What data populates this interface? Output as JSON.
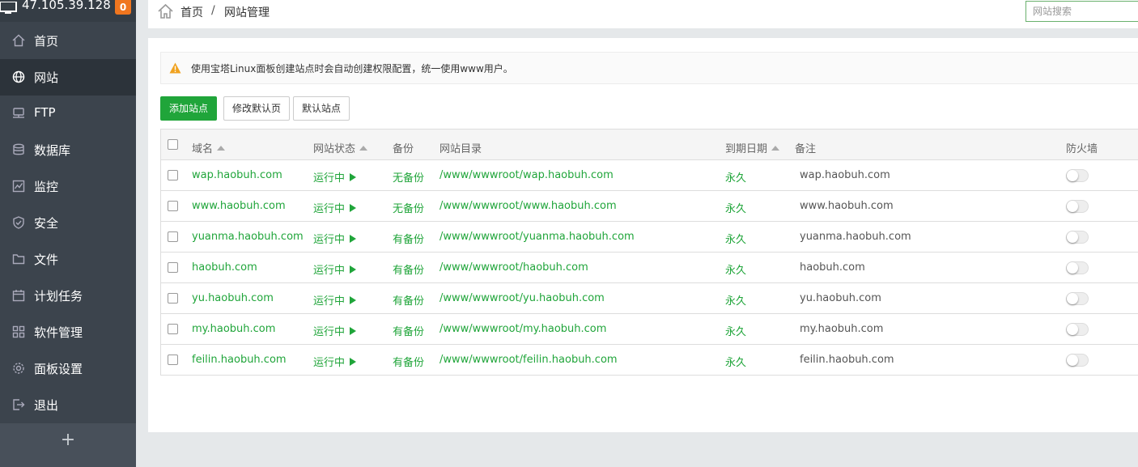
{
  "sidebar": {
    "ip": "47.105.39.128",
    "badge": "0",
    "items": [
      {
        "label": "首页",
        "icon": "home-icon"
      },
      {
        "label": "网站",
        "icon": "globe-icon"
      },
      {
        "label": "FTP",
        "icon": "ftp-icon"
      },
      {
        "label": "数据库",
        "icon": "database-icon"
      },
      {
        "label": "监控",
        "icon": "monitor-icon"
      },
      {
        "label": "安全",
        "icon": "shield-icon"
      },
      {
        "label": "文件",
        "icon": "folder-icon"
      },
      {
        "label": "计划任务",
        "icon": "calendar-icon"
      },
      {
        "label": "软件管理",
        "icon": "apps-icon"
      },
      {
        "label": "面板设置",
        "icon": "gear-icon"
      },
      {
        "label": "退出",
        "icon": "logout-icon"
      }
    ],
    "active_item": "网站",
    "add_label": "+"
  },
  "breadcrumb": {
    "home": "首页",
    "separator": "/",
    "current": "网站管理"
  },
  "search": {
    "placeholder": "网站搜索",
    "value": ""
  },
  "notice": {
    "text": "使用宝塔Linux面板创建站点时会自动创建权限配置，统一使用www用户。"
  },
  "toolbar": {
    "add_site_label": "添加站点",
    "edit_default_page_label": "修改默认页",
    "default_site_label": "默认站点"
  },
  "table": {
    "headers": {
      "domain": "域名",
      "status": "网站状态",
      "backup": "备份",
      "path": "网站目录",
      "expiry": "到期日期",
      "remark": "备注",
      "firewall": "防火墙"
    },
    "rows": [
      {
        "domain": "wap.haobuh.com",
        "status": "运行中",
        "backup": "无备份",
        "path": "/www/wwwroot/wap.haobuh.com",
        "expiry": "永久",
        "remark": "wap.haobuh.com",
        "firewall": false
      },
      {
        "domain": "www.haobuh.com",
        "status": "运行中",
        "backup": "无备份",
        "path": "/www/wwwroot/www.haobuh.com",
        "expiry": "永久",
        "remark": "www.haobuh.com",
        "firewall": false
      },
      {
        "domain": "yuanma.haobuh.com",
        "status": "运行中",
        "backup": "有备份",
        "path": "/www/wwwroot/yuanma.haobuh.com",
        "expiry": "永久",
        "remark": "yuanma.haobuh.com",
        "firewall": false
      },
      {
        "domain": "haobuh.com",
        "status": "运行中",
        "backup": "有备份",
        "path": "/www/wwwroot/haobuh.com",
        "expiry": "永久",
        "remark": "haobuh.com",
        "firewall": false
      },
      {
        "domain": "yu.haobuh.com",
        "status": "运行中",
        "backup": "有备份",
        "path": "/www/wwwroot/yu.haobuh.com",
        "expiry": "永久",
        "remark": "yu.haobuh.com",
        "firewall": false
      },
      {
        "domain": "my.haobuh.com",
        "status": "运行中",
        "backup": "有备份",
        "path": "/www/wwwroot/my.haobuh.com",
        "expiry": "永久",
        "remark": "my.haobuh.com",
        "firewall": false
      },
      {
        "domain": "feilin.haobuh.com",
        "status": "运行中",
        "backup": "有备份",
        "path": "/www/wwwroot/feilin.haobuh.com",
        "expiry": "永久",
        "remark": "feilin.haobuh.com",
        "firewall": false
      }
    ]
  },
  "colors": {
    "accent": "#20a53a",
    "sidebar_bg": "#3c444d",
    "sidebar_active": "#2c333a",
    "badge": "#f0761f",
    "warning": "#f0a21f"
  }
}
